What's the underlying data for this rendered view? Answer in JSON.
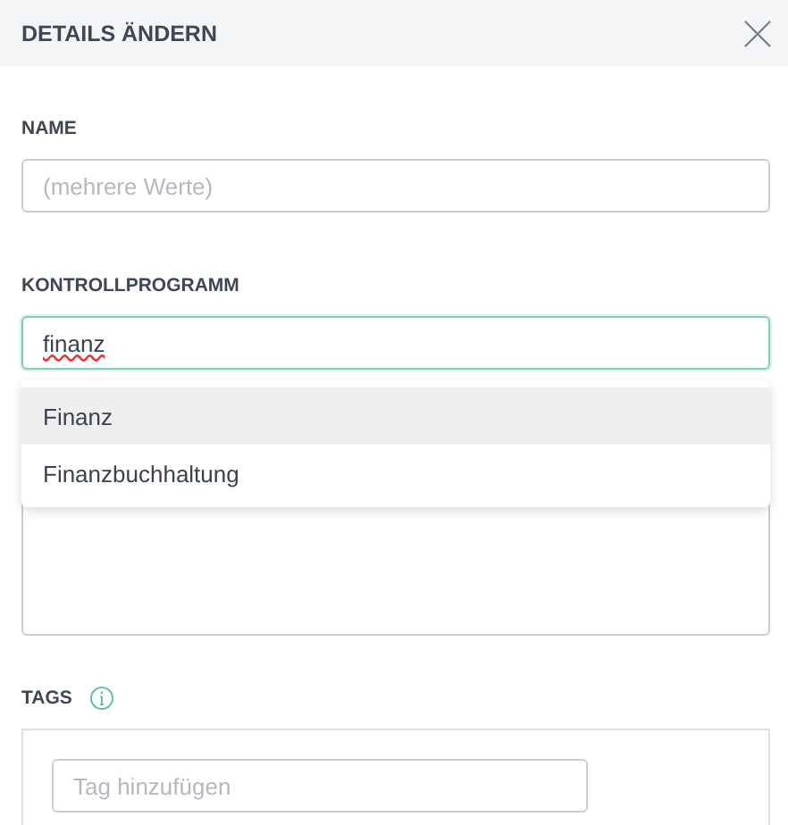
{
  "dialog": {
    "title": "DETAILS ÄNDERN"
  },
  "name_field": {
    "label": "NAME",
    "placeholder": "(mehrere Werte)"
  },
  "program_field": {
    "label": "KONTROLLPROGRAMM",
    "value": "finanz",
    "focused": true,
    "suggestions": [
      {
        "label": "Finanz",
        "selected": true
      },
      {
        "label": "Finanzbuchhaltung",
        "selected": false
      }
    ]
  },
  "tags": {
    "label": "TAGS",
    "placeholder": "Tag hinzufügen"
  }
}
